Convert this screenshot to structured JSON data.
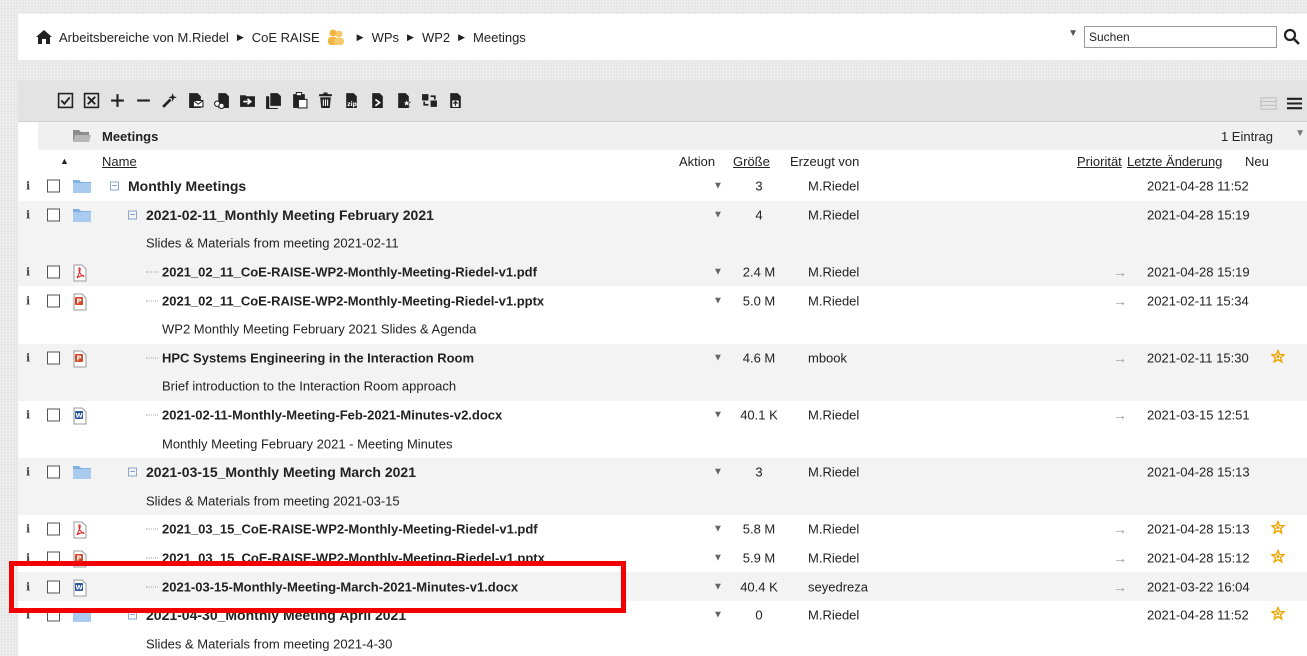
{
  "breadcrumb": {
    "items": [
      "Arbeitsbereiche von M.Riedel",
      "CoE RAISE",
      "WPs",
      "WP2",
      "Meetings"
    ]
  },
  "search": {
    "placeholder": "Suchen"
  },
  "folder_header": {
    "title": "Meetings",
    "count": "1 Eintrag"
  },
  "columns": {
    "name": "Name",
    "action": "Aktion",
    "size": "Größe",
    "created_by": "Erzeugt von",
    "priority": "Priorität",
    "last_changed": "Letzte Änderung",
    "new": "Neu"
  },
  "rows": [
    {
      "type": "folder",
      "title": "Monthly Meetings",
      "size": "3",
      "by": "M.Riedel",
      "date": "2021-04-28 11:52"
    },
    {
      "type": "folder",
      "title": "2021-02-11_Monthly Meeting February 2021",
      "size": "4",
      "by": "M.Riedel",
      "date": "2021-04-28 15:19"
    },
    {
      "type": "desc",
      "text": "Slides & Materials from meeting 2021-02-11"
    },
    {
      "type": "file",
      "icon": "pdf",
      "title": "2021_02_11_CoE-RAISE-WP2-Monthly-Meeting-Riedel-v1.pdf",
      "size": "2.4 M",
      "by": "M.Riedel",
      "date": "2021-04-28 15:19"
    },
    {
      "type": "file",
      "icon": "pptx",
      "title": "2021_02_11_CoE-RAISE-WP2-Monthly-Meeting-Riedel-v1.pptx",
      "size": "5.0 M",
      "by": "M.Riedel",
      "date": "2021-02-11 15:34"
    },
    {
      "type": "desc",
      "text": "WP2 Monthly Meeting February 2021 Slides & Agenda"
    },
    {
      "type": "file",
      "icon": "pptx",
      "title": "HPC Systems Engineering in the Interaction Room",
      "size": "4.6 M",
      "by": "mbook",
      "date": "2021-02-11 15:30",
      "new": true
    },
    {
      "type": "desc",
      "text": "Brief introduction to the Interaction Room approach"
    },
    {
      "type": "file",
      "icon": "docx",
      "title": "2021-02-11-Monthly-Meeting-Feb-2021-Minutes-v2.docx",
      "size": "40.1 K",
      "by": "M.Riedel",
      "date": "2021-03-15 12:51"
    },
    {
      "type": "desc",
      "text": "Monthly Meeting February 2021 - Meeting Minutes"
    },
    {
      "type": "folder",
      "title": "2021-03-15_Monthly Meeting March 2021",
      "size": "3",
      "by": "M.Riedel",
      "date": "2021-04-28 15:13"
    },
    {
      "type": "desc",
      "text": "Slides & Materials from meeting 2021-03-15"
    },
    {
      "type": "file",
      "icon": "pdf",
      "title": "2021_03_15_CoE-RAISE-WP2-Monthly-Meeting-Riedel-v1.pdf",
      "size": "5.8 M",
      "by": "M.Riedel",
      "date": "2021-04-28 15:13",
      "new": true
    },
    {
      "type": "file",
      "icon": "pptx",
      "title": "2021_03_15_CoE-RAISE-WP2-Monthly-Meeting-Riedel-v1.pptx",
      "size": "5.9 M",
      "by": "M.Riedel",
      "date": "2021-04-28 15:12",
      "new": true
    },
    {
      "type": "file",
      "icon": "docx",
      "title": "2021-03-15-Monthly-Meeting-March-2021-Minutes-v1.docx",
      "size": "40.4 K",
      "by": "seyedreza",
      "date": "2021-03-22 16:04"
    },
    {
      "type": "folder",
      "title": "2021-04-30_Monthly Meeting April 2021",
      "size": "0",
      "by": "M.Riedel",
      "date": "2021-04-28 11:52",
      "new": true
    },
    {
      "type": "desc",
      "text": "Slides & Materials from meeting 2021-4-30"
    }
  ],
  "colors": {
    "highlight": "#f20000",
    "folder": "#5b9bd5",
    "pdf": "#d9261c",
    "pptx": "#d24726",
    "docx": "#2b579a",
    "star": "#f0a400"
  }
}
